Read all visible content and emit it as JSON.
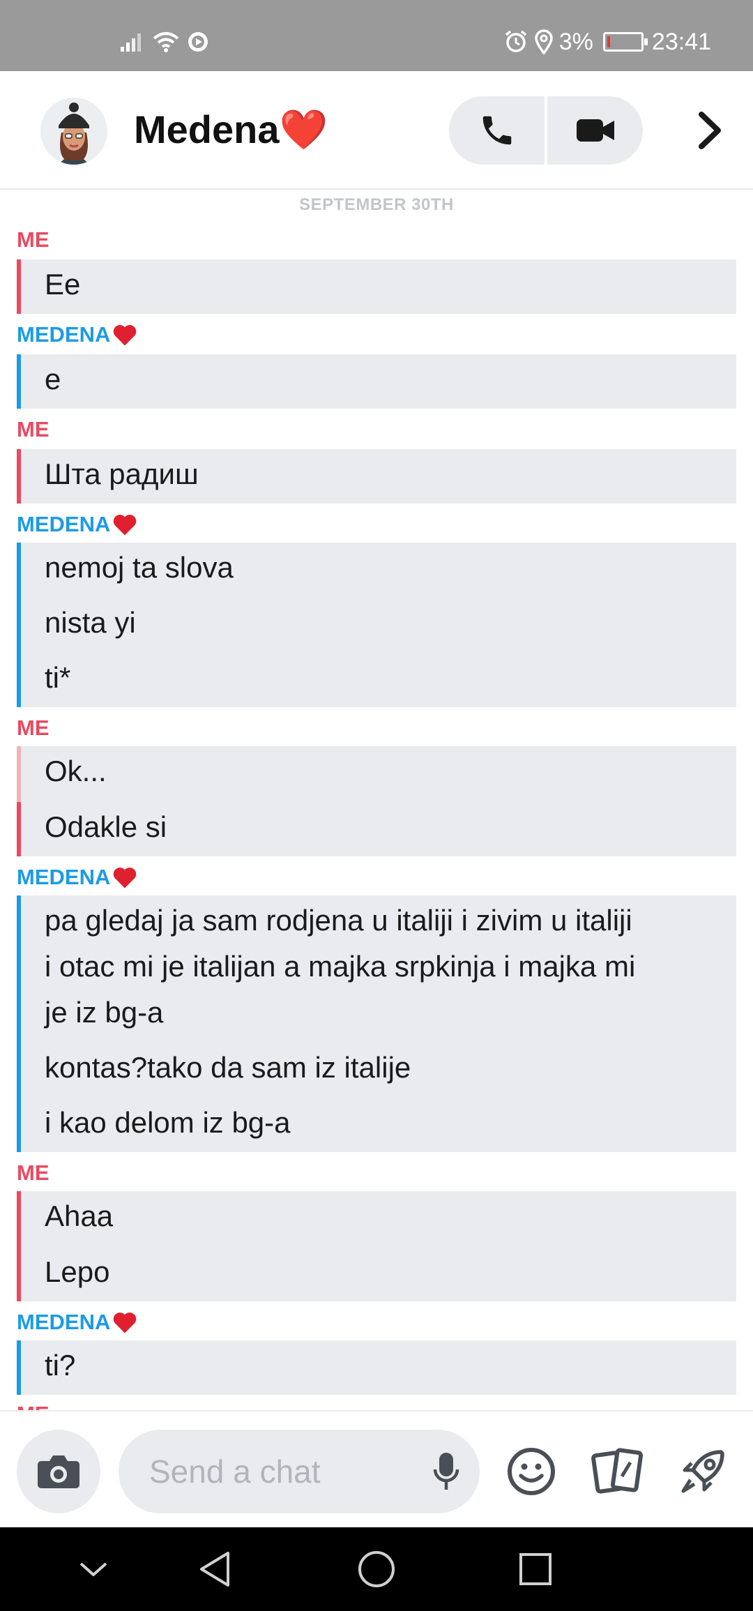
{
  "status_bar": {
    "battery_percent": "3%",
    "time": "23:41"
  },
  "header": {
    "contact_name": "Medena❤️"
  },
  "chat": {
    "date_separator": "SEPTEMBER 30TH",
    "groups": [
      {
        "sender": "ME",
        "messages": [
          "Ee"
        ]
      },
      {
        "sender": "MEDENA",
        "messages": [
          "e"
        ]
      },
      {
        "sender": "ME",
        "messages": [
          "Шта радиш"
        ]
      },
      {
        "sender": "MEDENA",
        "messages": [
          "nemoj ta slova",
          "nista yi",
          "ti*"
        ]
      },
      {
        "sender": "ME",
        "messages": [
          "Ok...",
          "Odakle si"
        ]
      },
      {
        "sender": "MEDENA",
        "messages": [
          "pa gledaj ja sam rodjena u italiji i zivim u italiji",
          "i otac mi je italijan a majka srpkinja i majka mi",
          "je iz bg-a",
          "kontas?tako da sam iz italije",
          "i kao delom iz bg-a"
        ]
      },
      {
        "sender": "ME",
        "messages": [
          "Ahaa",
          "Lepo"
        ]
      },
      {
        "sender": "MEDENA",
        "messages": [
          "ti?"
        ]
      }
    ],
    "cut_off_sender": "ME"
  },
  "input_bar": {
    "placeholder": "Send a chat"
  },
  "colors": {
    "me": "#e94a60",
    "them": "#1c9be5",
    "bubble_bg": "#e9ebee"
  },
  "icons": [
    "signal-icon",
    "wifi-icon",
    "cast-icon",
    "alarm-icon",
    "location-icon",
    "battery-icon",
    "phone-icon",
    "video-icon",
    "chevron-right-icon",
    "camera-icon",
    "mic-icon",
    "smiley-icon",
    "stickers-icon",
    "rocket-icon",
    "nav-collapse-icon",
    "nav-back-icon",
    "nav-home-icon",
    "nav-recents-icon"
  ]
}
